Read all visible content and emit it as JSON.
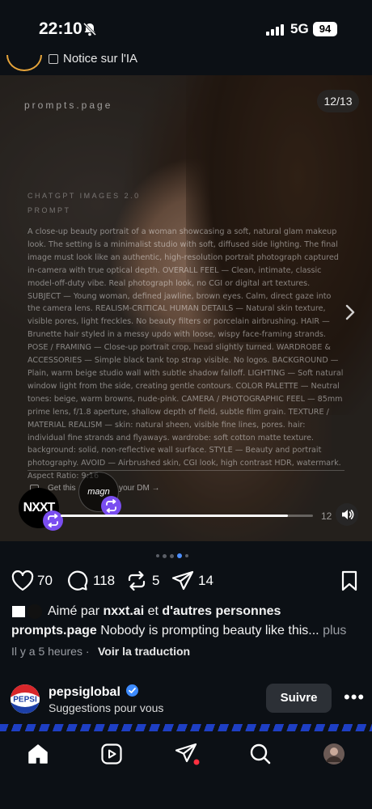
{
  "status_bar": {
    "time": "22:10",
    "network": "5G",
    "battery": "94"
  },
  "header": {
    "ai_notice": "Notice sur l'IA"
  },
  "media": {
    "brand": "prompts.page",
    "counter": "12/13",
    "prompt_title": "CHATGPT IMAGES 2.0",
    "prompt_subtitle": "PROMPT",
    "prompt_text": "A close-up beauty portrait of a woman showcasing a soft, natural glam makeup look. The setting is a minimalist studio with soft, diffused side lighting. The final image must look like an authentic, high-resolution portrait photograph captured in-camera with true optical depth. OVERALL FEEL — Clean, intimate, classic model-off-duty vibe. Real photograph look, no CGI or digital art textures. SUBJECT — Young woman, defined jawline, brown eyes. Calm, direct gaze into the camera lens. REALISM-CRITICAL HUMAN DETAILS — Natural skin texture, visible pores, light freckles. No beauty filters or porcelain airbrushing. HAIR — Brunette hair styled in a messy updo with loose, wispy face-framing strands. POSE / FRAMING — Close-up portrait crop, head slightly turned. WARDROBE & ACCESSORIES — Simple black tank top strap visible. No logos. BACKGROUND — Plain, warm beige studio wall with subtle shadow falloff. LIGHTING — Soft natural window light from the side, creating gentle contours. COLOR PALETTE — Neutral tones: beige, warm browns, nude-pink. CAMERA / PHOTOGRAPHIC FEEL — 85mm prime lens, f/1.8 aperture, shallow depth of field, subtle film grain. TEXTURE / MATERIAL REALISM — skin: natural sheen, visible fine lines, pores. hair: individual fine strands and flyaways. wardrobe: soft cotton matte texture. background: solid, non-reflective wall surface. STYLE — Beauty and portrait photography. AVOID — Airbrushed skin, CGI look, high contrast HDR, watermark. Aspect Ratio: 9:16",
    "dm_text_left": "Get this",
    "dm_text_right": "your DM →",
    "magn_label": "magn",
    "creator_badge": "NXXT",
    "playback_time": "12",
    "progress": 0.9
  },
  "carousel": {
    "dot_count": 5,
    "active_index": 3
  },
  "actions": {
    "likes": "70",
    "comments": "118",
    "reposts": "5",
    "shares": "14"
  },
  "likes_line": {
    "prefix": "Aimé par",
    "user": "nxxt.ai",
    "middle": "et",
    "others": "d'autres personnes"
  },
  "caption": {
    "username": "prompts.page",
    "text": "Nobody is prompting beauty like this...",
    "more": "plus"
  },
  "meta": {
    "time_ago": "Il y a 5 heures",
    "separator": "·",
    "translate": "Voir la traduction"
  },
  "suggested": {
    "account": "pepsiglobal",
    "logo_text": "PEPSI",
    "subtitle": "Suggestions pour vous",
    "follow_label": "Suivre",
    "more_label": "•••"
  },
  "colors": {
    "accent_blue": "#4c8fff",
    "remix_purple": "#7a4df0",
    "verified_blue": "#3d8bff",
    "notification_red": "#ff3040"
  }
}
